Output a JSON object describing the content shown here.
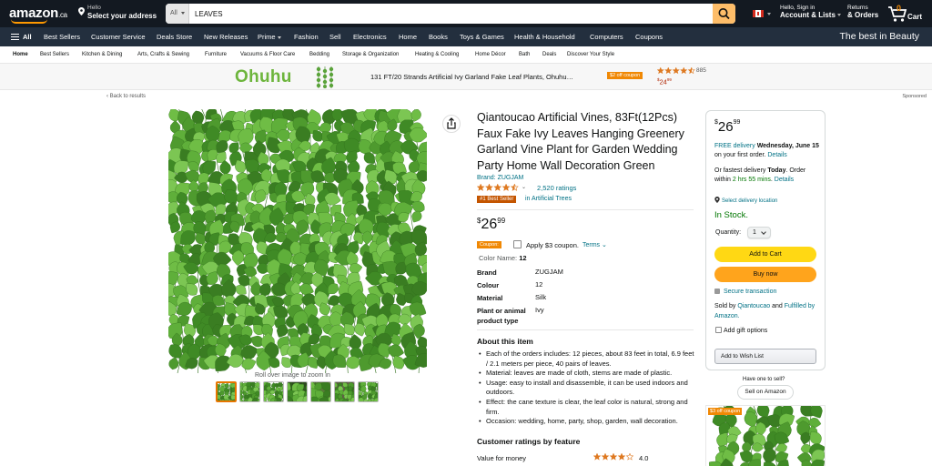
{
  "header": {
    "logo": "amazon",
    "logo_suffix": ".ca",
    "address_line1": "Hello",
    "address_line2": "Select your address",
    "search_category": "All",
    "search_value": "LEAVES",
    "account_line1": "Hello, Sign in",
    "account_line2": "Account & Lists",
    "orders_line1": "Returns",
    "orders_line2": "& Orders",
    "cart_count": "0",
    "cart_label": "Cart"
  },
  "nav": {
    "all": "All",
    "items": [
      "Best Sellers",
      "Customer Service",
      "Deals Store",
      "New Releases",
      "Prime",
      "Fashion",
      "Sell",
      "Electronics",
      "Home",
      "Books",
      "Toys & Games",
      "Health & Household",
      "Computers",
      "Coupons"
    ],
    "promo": "The best in Beauty"
  },
  "subnav": {
    "items": [
      "Home",
      "Best Sellers",
      "Kitchen & Dining",
      "Arts, Crafts & Sewing",
      "Furniture",
      "Vacuums & Floor Care",
      "Bedding",
      "Storage & Organization",
      "Heating & Cooling",
      "Home Décor",
      "Bath",
      "Deals",
      "Discover Your Style"
    ]
  },
  "ad_banner": {
    "brand": "Ohuhu",
    "title": "131 FT/20 Strands Artificial Ivy Garland Fake Leaf Plants, Ohuhu…",
    "coupon": "$2 off coupon",
    "rating_count": "885",
    "price_symbol": "$",
    "price_whole": "24",
    "price_frac": "99",
    "rating": 4.5
  },
  "back_link": "‹ Back to results",
  "sponsored": "Sponsored",
  "gallery": {
    "zoom_hint": "Roll over image to zoom in",
    "thumb_count": 7
  },
  "product": {
    "title": "Qiantoucao Artificial Vines, 83Ft(12Pcs) Faux Fake Ivy Leaves Hanging Greenery Garland Vine Plant for Garden Wedding Party Home Wall Decoration Green",
    "brand": "Brand: ZUGJAM",
    "rating": 4.5,
    "rating_count": "2,520 ratings",
    "best_seller_badge": "#1 Best Seller",
    "best_seller_category": "in Artificial Trees",
    "price_symbol": "$",
    "price_whole": "26",
    "price_frac": "99",
    "coupon_tag": "Coupon:",
    "coupon_text": "Apply $3 coupon.",
    "coupon_terms": "Terms",
    "color_label": "Color Name:",
    "color_value": "12",
    "specs": [
      {
        "key": "Brand",
        "value": "ZUGJAM"
      },
      {
        "key": "Colour",
        "value": "12"
      },
      {
        "key": "Material",
        "value": "Silk"
      },
      {
        "key": "Plant or animal product type",
        "value": "Ivy"
      }
    ],
    "about_heading": "About this item",
    "about": [
      "Each of the orders includes: 12 pieces, about 83 feet in total, 6.9 feet / 2.1 meters per piece, 40 pairs of leaves.",
      "Material: leaves are made of cloth, stems are made of plastic.",
      "Usage: easy to install and disassemble, it can be used indoors and outdoors.",
      "Effect: the cane texture is clear, the leaf color is natural, strong and firm.",
      "Occasion: wedding, home, party, shop, garden, wall decoration."
    ],
    "customer_ratings_heading": "Customer ratings by feature",
    "feature_name": "Value for money",
    "feature_value": "4.0",
    "feature_rating": 4.0
  },
  "buybox": {
    "price_symbol": "$",
    "price_whole": "26",
    "price_frac": "99",
    "free_delivery": "FREE delivery",
    "delivery_date": "Wednesday, June 15",
    "delivery_suffix": "on your first order.",
    "details": "Details",
    "fastest_prefix": "Or fastest delivery",
    "fastest_day": "Today",
    "fastest_mid": ". Order within",
    "fastest_time": "2 hrs 55 mins",
    "fastest_details": "Details",
    "location": "Select delivery location",
    "stock": "In Stock.",
    "quantity_label": "Quantity:",
    "quantity_value": "1",
    "add_to_cart": "Add to Cart",
    "buy_now": "Buy now",
    "secure": "Secure transaction",
    "sold_by_prefix": "Sold by",
    "seller": "Qiantoucao",
    "sold_by_and": "and",
    "fulfilled": "Fulfilled by Amazon.",
    "gift": "Add gift options",
    "wishlist": "Add to Wish List"
  },
  "sell": {
    "have_one": "Have one to sell?",
    "button": "Sell on Amazon"
  },
  "side_ad": {
    "coupon": "$3 off coupon"
  },
  "colors": {
    "header_bg": "#131921",
    "nav_bg": "#232f3e",
    "accent": "#ff9900",
    "link": "#007185",
    "stock": "#007600",
    "cart_btn": "#ffd814",
    "buy_btn": "#ffa41c",
    "bestseller": "#c45500",
    "leaf": "#4e9a2e"
  }
}
